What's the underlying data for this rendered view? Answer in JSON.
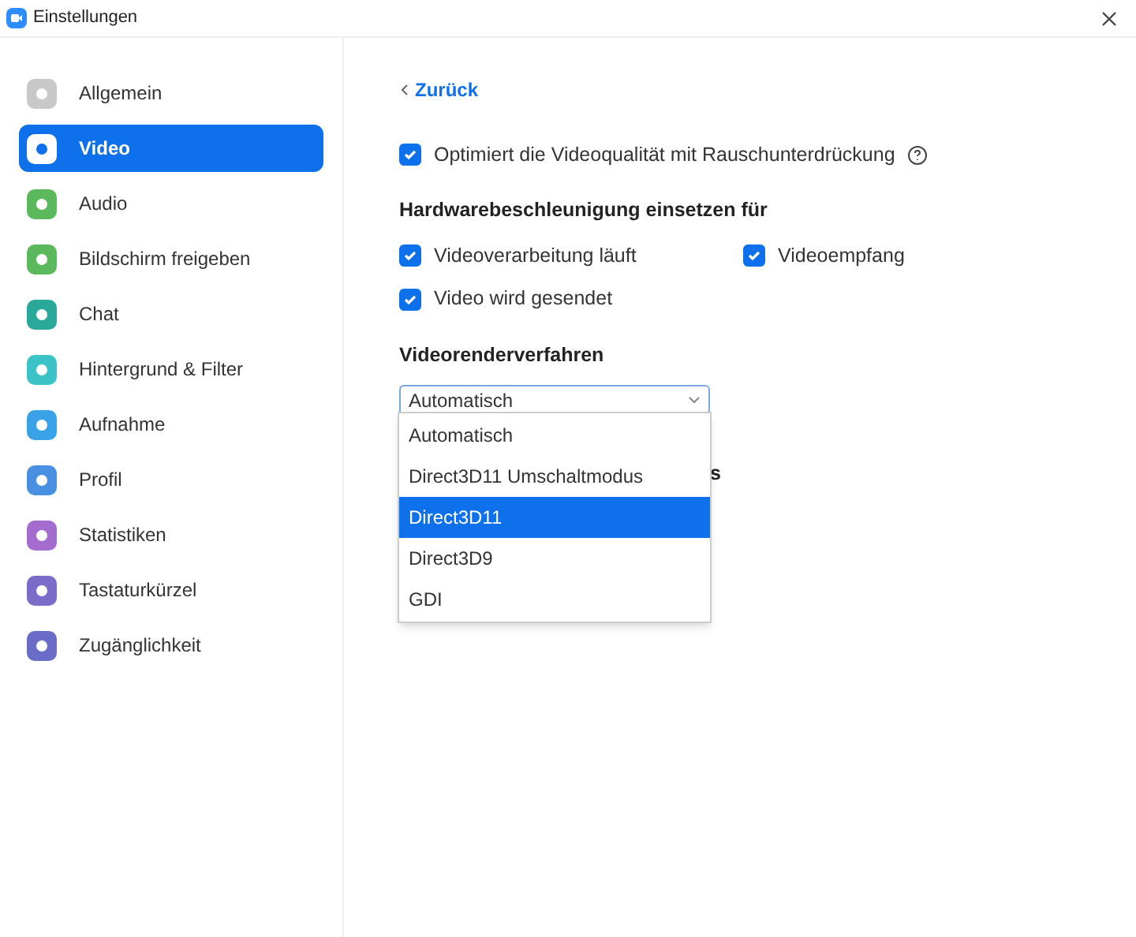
{
  "window": {
    "title": "Einstellungen"
  },
  "sidebar": {
    "items": [
      {
        "label": "Allgemein",
        "selected": false,
        "color": "#c8c8c8"
      },
      {
        "label": "Video",
        "selected": true,
        "color": "#ffffff"
      },
      {
        "label": "Audio",
        "selected": false,
        "color": "#5cb85c"
      },
      {
        "label": "Bildschirm freigeben",
        "selected": false,
        "color": "#5cb85c"
      },
      {
        "label": "Chat",
        "selected": false,
        "color": "#2aa89a"
      },
      {
        "label": "Hintergrund & Filter",
        "selected": false,
        "color": "#3cc3c8"
      },
      {
        "label": "Aufnahme",
        "selected": false,
        "color": "#3aa3e8"
      },
      {
        "label": "Profil",
        "selected": false,
        "color": "#4a90e2"
      },
      {
        "label": "Statistiken",
        "selected": false,
        "color": "#a56cd0"
      },
      {
        "label": "Tastaturkürzel",
        "selected": false,
        "color": "#7a6cc8"
      },
      {
        "label": "Zugänglichkeit",
        "selected": false,
        "color": "#6a6cc8"
      }
    ]
  },
  "back_link": "Zurück",
  "noise_option": {
    "label": "Optimiert die Videoqualität mit Rauschunterdrückung",
    "checked": true
  },
  "hardware": {
    "heading": "Hardwarebeschleunigung einsetzen für",
    "options": [
      {
        "label": "Videoverarbeitung läuft",
        "checked": true
      },
      {
        "label": "Videoempfang",
        "checked": true
      },
      {
        "label": "Video wird gesendet",
        "checked": true
      }
    ]
  },
  "render": {
    "heading": "Videorenderverfahren",
    "value": "Automatisch",
    "hidden_heading": "s",
    "options": [
      {
        "label": "Automatisch",
        "highlighted": false
      },
      {
        "label": "Direct3D11 Umschaltmodus",
        "highlighted": false
      },
      {
        "label": "Direct3D11",
        "highlighted": true
      },
      {
        "label": "Direct3D9",
        "highlighted": false
      },
      {
        "label": "GDI",
        "highlighted": false
      }
    ]
  }
}
